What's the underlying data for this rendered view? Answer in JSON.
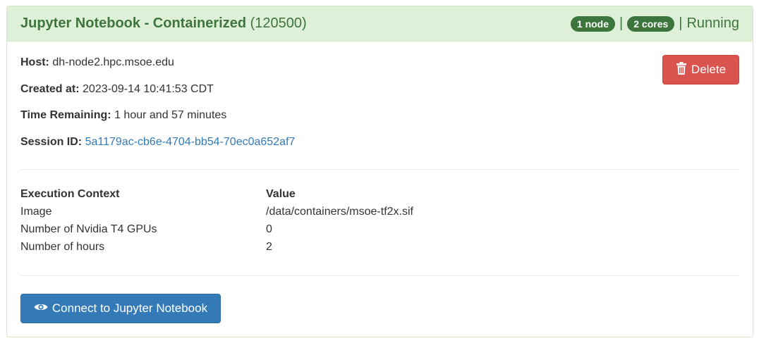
{
  "session": {
    "title": "Jupyter Notebook - Containerized",
    "job_id": "(120500)",
    "nodes_badge": "1 node",
    "cores_badge": "2 cores",
    "separator": "|",
    "status": "Running"
  },
  "details": {
    "host_label": "Host:",
    "host_value": "dh-node2.hpc.msoe.edu",
    "created_label": "Created at:",
    "created_value": "2023-09-14 10:41:53 CDT",
    "remaining_label": "Time Remaining:",
    "remaining_value": "1 hour and 57 minutes",
    "session_id_label": "Session ID:",
    "session_id_value": "5a1179ac-cb6e-4704-bb54-70ec0a652af7"
  },
  "actions": {
    "delete_label": "Delete",
    "connect_label": "Connect to Jupyter Notebook"
  },
  "context_table": {
    "headers": [
      "Execution Context",
      "Value"
    ],
    "rows": [
      [
        "Image",
        "/data/containers/msoe-tf2x.sif"
      ],
      [
        "Number of Nvidia T4 GPUs",
        "0"
      ],
      [
        "Number of hours",
        "2"
      ]
    ]
  },
  "colors": {
    "success_text": "#3c763d",
    "heading_bg": "#dff0d8",
    "danger": "#d9534f",
    "primary": "#337ab7"
  },
  "icons": {
    "delete": "trash-icon",
    "connect": "eye-icon"
  }
}
